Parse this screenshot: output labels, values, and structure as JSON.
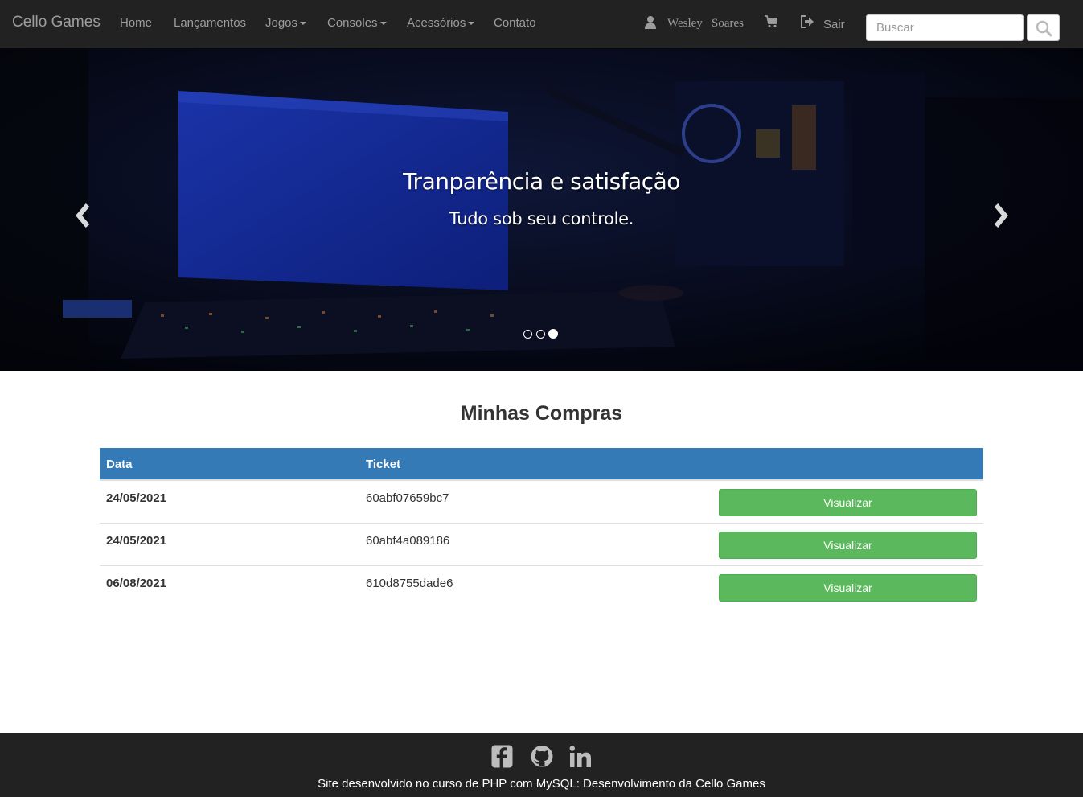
{
  "navbar": {
    "brand": "Cello Games",
    "links": [
      {
        "label": "Home",
        "dropdown": false
      },
      {
        "label": "Lançamentos",
        "dropdown": false
      },
      {
        "label": "Jogos",
        "dropdown": true
      },
      {
        "label": "Consoles",
        "dropdown": true
      },
      {
        "label": "Acessórios",
        "dropdown": true
      },
      {
        "label": "Contato",
        "dropdown": false
      }
    ],
    "user": {
      "first_name": "Wesley",
      "last_name": "Soares",
      "icon": "user-icon"
    },
    "cart_icon": "shopping-cart-icon",
    "logout": {
      "label": "Sair",
      "icon": "log-out-icon"
    },
    "search": {
      "placeholder": "Buscar",
      "value": "",
      "icon": "search-icon"
    }
  },
  "carousel": {
    "title": "Tranparência e satisfação",
    "subtitle": "Tudo sob seu controle.",
    "prev_icon": "chevron-left-icon",
    "next_icon": "chevron-right-icon",
    "slide_count": 3,
    "active_index": 2
  },
  "main": {
    "title": "Minhas Compras",
    "table": {
      "columns": [
        "Data",
        "Ticket",
        ""
      ],
      "rows": [
        {
          "date": "24/05/2021",
          "ticket": "60abf07659bc7",
          "action": "Visualizar"
        },
        {
          "date": "24/05/2021",
          "ticket": "60abf4a089186",
          "action": "Visualizar"
        },
        {
          "date": "06/08/2021",
          "ticket": "610d8755dade6",
          "action": "Visualizar"
        }
      ]
    }
  },
  "footer": {
    "social_icons": [
      "facebook-icon",
      "github-icon",
      "linkedin-icon"
    ],
    "text": "Site desenvolvido no curso de PHP com MySQL: Desenvolvimento da Cello Games"
  },
  "colors": {
    "navbar_bg": "#222222",
    "table_header": "#337ab7",
    "button_success": "#5cb85c",
    "footer_bg": "#222222"
  }
}
